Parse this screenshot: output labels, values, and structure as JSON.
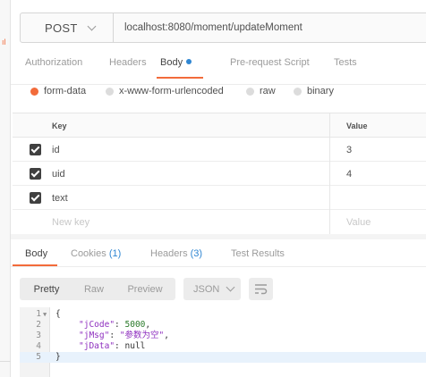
{
  "request": {
    "method": "POST",
    "url": "localhost:8080/moment/updateMoment"
  },
  "request_tabs": [
    {
      "label": "Authorization",
      "active": false
    },
    {
      "label": "Headers",
      "active": false
    },
    {
      "label": "Body",
      "active": true
    },
    {
      "label": "Pre-request Script",
      "active": false
    },
    {
      "label": "Tests",
      "active": false
    }
  ],
  "body_types": [
    {
      "label": "form-data",
      "selected": true
    },
    {
      "label": "x-www-form-urlencoded",
      "selected": false
    },
    {
      "label": "raw",
      "selected": false
    },
    {
      "label": "binary",
      "selected": false
    }
  ],
  "params_table": {
    "headers": {
      "key": "Key",
      "value": "Value"
    },
    "rows": [
      {
        "checked": true,
        "key": "id",
        "value": "3"
      },
      {
        "checked": true,
        "key": "uid",
        "value": "4"
      },
      {
        "checked": true,
        "key": "text",
        "value": ""
      }
    ],
    "new_row": {
      "key_placeholder": "New key",
      "value_placeholder": "Value"
    }
  },
  "response_tabs": [
    {
      "label": "Body",
      "count": "",
      "active": true
    },
    {
      "label": "Cookies",
      "count": "(1)",
      "active": false
    },
    {
      "label": "Headers",
      "count": "(3)",
      "active": false
    },
    {
      "label": "Test Results",
      "count": "",
      "active": false
    }
  ],
  "view_modes": [
    {
      "label": "Pretty",
      "active": true
    },
    {
      "label": "Raw",
      "active": false
    },
    {
      "label": "Preview",
      "active": false
    }
  ],
  "format": "JSON",
  "response_code": {
    "line_numbers": [
      "1",
      "2",
      "3",
      "4",
      "5"
    ],
    "open_brace": "{",
    "close_brace": "}",
    "fields": [
      {
        "key": "\"jCode\"",
        "sep": ": ",
        "value": "5000",
        "value_type": "number",
        "trail": ","
      },
      {
        "key": "\"jMsg\"",
        "sep": ": ",
        "value": "\"参数为空\"",
        "value_type": "string",
        "trail": ","
      },
      {
        "key": "\"jData\"",
        "sep": ": ",
        "value": "null",
        "value_type": "keyword",
        "trail": ""
      }
    ]
  },
  "colors": {
    "accent": "#f26b3a",
    "link_blue": "#2f86d2",
    "json_key": "#8e2fbf",
    "json_number": "#2a7a2a"
  },
  "icons": [
    "chevron-down-icon",
    "checkbox-checked-icon",
    "radio-icon",
    "wrap-lines-icon",
    "fold-arrow-icon"
  ]
}
